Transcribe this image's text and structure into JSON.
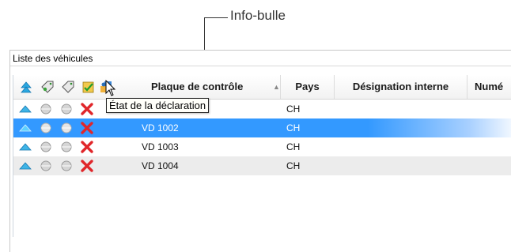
{
  "callout": {
    "label": "Info-bulle"
  },
  "group": {
    "title": "Liste des véhicules"
  },
  "columns": {
    "icons": [
      "sort-up-icon",
      "tag-icon",
      "tag-icon",
      "status-check-icon",
      "users-icon"
    ],
    "plate": "Plaque de contrôle",
    "country": "Pays",
    "internal": "Désignation interne",
    "number": "Numé"
  },
  "tooltip": {
    "text": "État de la déclaration"
  },
  "rows": [
    {
      "plate": "",
      "country": "CH",
      "internal": "",
      "status": "error"
    },
    {
      "plate": "VD 1002",
      "country": "CH",
      "internal": "",
      "status": "error",
      "selected": true
    },
    {
      "plate": "VD 1003",
      "country": "CH",
      "internal": "",
      "status": "error"
    },
    {
      "plate": "VD 1004",
      "country": "CH",
      "internal": "",
      "status": "error"
    }
  ],
  "colors": {
    "selection": "#3399ff",
    "alt_row": "#ececec",
    "error": "#e0262a"
  }
}
